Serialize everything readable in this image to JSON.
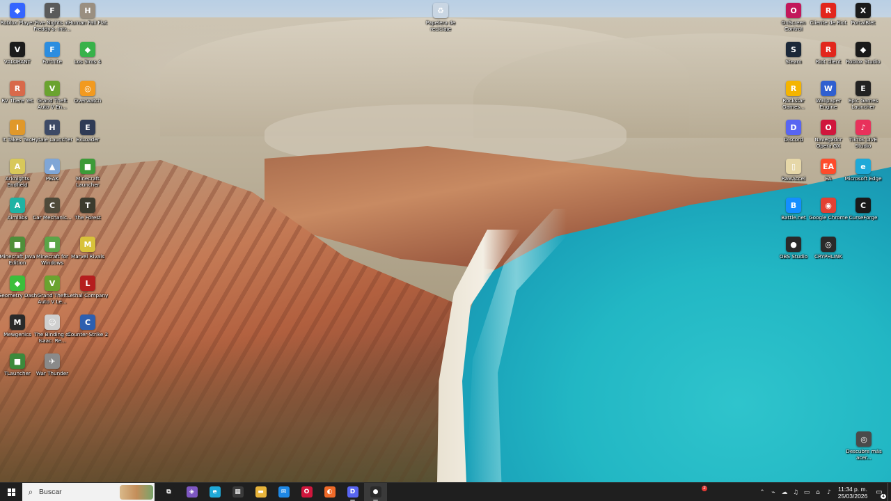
{
  "desktop": {
    "icons": [
      {
        "label": "Roblox Player",
        "icon": "roblox-icon",
        "color": "#3565ff",
        "glyph": "◆"
      },
      {
        "label": "Five Nights at Freddy's: Intr...",
        "icon": "fnaf-icon",
        "color": "#5a5a5a",
        "glyph": "F"
      },
      {
        "label": "Human Fall Flat",
        "icon": "human-fall-flat-icon",
        "color": "#9a8f80",
        "glyph": "H"
      },
      {
        "label": "VALORANT",
        "icon": "valorant-icon",
        "color": "#1b1b1b",
        "glyph": "V"
      },
      {
        "label": "Fortnite",
        "icon": "fortnite-icon",
        "color": "#2b8de0",
        "glyph": "F"
      },
      {
        "label": "Los Sims 4",
        "icon": "sims-icon",
        "color": "#38b24a",
        "glyph": "◆"
      },
      {
        "label": "RV There Yet",
        "icon": "rv-there-yet-icon",
        "color": "#d8694a",
        "glyph": "R"
      },
      {
        "label": "Grand Theft Auto V En...",
        "icon": "gta-v-icon",
        "color": "#6aa32f",
        "glyph": "V"
      },
      {
        "label": "Overwatch",
        "icon": "overwatch-icon",
        "color": "#f29a1f",
        "glyph": "◎"
      },
      {
        "label": "It Takes Two",
        "icon": "it-takes-two-icon",
        "color": "#e0982a",
        "glyph": "I"
      },
      {
        "label": "Hytale Launcher",
        "icon": "hytale-icon",
        "color": "#3d4a66",
        "glyph": "H"
      },
      {
        "label": "ExLoader",
        "icon": "exloader-icon",
        "color": "#2f3b55",
        "glyph": "E"
      },
      {
        "label": "Arknights Endfield",
        "icon": "arknights-icon",
        "color": "#d8c85a",
        "glyph": "A"
      },
      {
        "label": "PEAK",
        "icon": "peak-icon",
        "color": "#7fa6d6",
        "glyph": "▲"
      },
      {
        "label": "Minecraft Launcher",
        "icon": "minecraft-launcher-icon",
        "color": "#3c9b38",
        "glyph": "■"
      },
      {
        "label": "Aimlabs",
        "icon": "aimlabs-icon",
        "color": "#1fb3a4",
        "glyph": "A"
      },
      {
        "label": "Car Mechanic...",
        "icon": "car-mechanic-icon",
        "color": "#4e4a3a",
        "glyph": "C"
      },
      {
        "label": "The Forest",
        "icon": "the-forest-icon",
        "color": "#3b3b2e",
        "glyph": "T"
      },
      {
        "label": "Minecraft Java Edition",
        "icon": "minecraft-java-icon",
        "color": "#4f8f3a",
        "glyph": "■"
      },
      {
        "label": "Minecraft for Windows",
        "icon": "minecraft-windows-icon",
        "color": "#5aa548",
        "glyph": "■"
      },
      {
        "label": "Marvel Rivals",
        "icon": "marvel-rivals-icon",
        "color": "#d8c23a",
        "glyph": "M"
      },
      {
        "label": "Geometry Dash",
        "icon": "geometry-dash-icon",
        "color": "#3bbf3b",
        "glyph": "◆"
      },
      {
        "label": "Grand Theft Auto V Le...",
        "icon": "gta-v-legacy-icon",
        "color": "#6aa32f",
        "glyph": "V"
      },
      {
        "label": "Lethal Company",
        "icon": "lethal-company-icon",
        "color": "#b51e1e",
        "glyph": "L"
      },
      {
        "label": "Mewgenics",
        "icon": "mewgenics-icon",
        "color": "#2a2a2a",
        "glyph": "M"
      },
      {
        "label": "The Binding of Isaac: Re...",
        "icon": "binding-of-isaac-icon",
        "color": "#cfcfcf",
        "glyph": "☺"
      },
      {
        "label": "Counter-Strike 2",
        "icon": "counter-strike-icon",
        "color": "#2d5fb0",
        "glyph": "C"
      },
      {
        "label": "TLauncher",
        "icon": "tlauncher-icon",
        "color": "#3c8a3c",
        "glyph": "■"
      },
      {
        "label": "War Thunder",
        "icon": "war-thunder-icon",
        "color": "#8a8a8a",
        "glyph": "✈"
      },
      {
        "label": "Papelera de reciclaje",
        "icon": "recycle-bin-icon",
        "color": "#c9d6e3",
        "glyph": "♻"
      },
      {
        "label": "OnScreen Control",
        "icon": "onscreen-control-icon",
        "color": "#c2185b",
        "glyph": "O"
      },
      {
        "label": "Cliente de Riot",
        "icon": "riot-client-icon",
        "color": "#e2261c",
        "glyph": "R"
      },
      {
        "label": "PortalBlet",
        "icon": "portalblet-icon",
        "color": "#1a1a1a",
        "glyph": "X"
      },
      {
        "label": "Steam",
        "icon": "steam-icon",
        "color": "#1b2838",
        "glyph": "S"
      },
      {
        "label": "Riot client",
        "icon": "riot-client-2-icon",
        "color": "#e2261c",
        "glyph": "R"
      },
      {
        "label": "Roblox Studio",
        "icon": "roblox-studio-icon",
        "color": "#1a1a1a",
        "glyph": "◆"
      },
      {
        "label": "Rockstar Games...",
        "icon": "rockstar-icon",
        "color": "#f4b400",
        "glyph": "R"
      },
      {
        "label": "Wallpaper Engine",
        "icon": "wallpaper-engine-icon",
        "color": "#2f5fd0",
        "glyph": "W"
      },
      {
        "label": "Epic Games Launcher",
        "icon": "epic-games-icon",
        "color": "#222222",
        "glyph": "E"
      },
      {
        "label": "Discord",
        "icon": "discord-icon",
        "color": "#5865f2",
        "glyph": "D"
      },
      {
        "label": "Navegador Opera GX",
        "icon": "opera-gx-icon",
        "color": "#d0163c",
        "glyph": "O"
      },
      {
        "label": "TikTok LIVE Studio",
        "icon": "tiktok-live-icon",
        "color": "#e8315b",
        "glyph": "♪"
      },
      {
        "label": "RawAccel",
        "icon": "rawaccel-icon",
        "color": "#e6d7a8",
        "glyph": "▯"
      },
      {
        "label": "EA",
        "icon": "ea-icon",
        "color": "#ff4b2b",
        "glyph": "EA"
      },
      {
        "label": "Microsoft Edge",
        "icon": "edge-icon",
        "color": "#1fa9d8",
        "glyph": "e"
      },
      {
        "label": "Battle.net",
        "icon": "battlenet-icon",
        "color": "#148eff",
        "glyph": "B"
      },
      {
        "label": "Google Chrome",
        "icon": "chrome-icon",
        "color": "#e34133",
        "glyph": "◉"
      },
      {
        "label": "CurseForge",
        "icon": "curseforge-icon",
        "color": "#1a1a1a",
        "glyph": "C"
      },
      {
        "label": "OBS Studio",
        "icon": "obs-icon",
        "color": "#2a2a2a",
        "glyph": "●"
      },
      {
        "label": "CRYPHLINK",
        "icon": "cryphlink-icon",
        "color": "#2a2a2a",
        "glyph": "◎"
      },
      {
        "label": "Descubre más acer...",
        "icon": "discover-icon",
        "color": "#4a4a4a",
        "glyph": "◎"
      }
    ]
  },
  "taskbar": {
    "search_placeholder": "Buscar",
    "apps": [
      {
        "name": "task-view-icon",
        "glyph": "⧉",
        "color": "#1f1f1f"
      },
      {
        "name": "copilot-icon",
        "glyph": "◈",
        "color": "#7e57c2"
      },
      {
        "name": "edge-taskbar-icon",
        "glyph": "e",
        "color": "#1fa9d8"
      },
      {
        "name": "store-icon",
        "glyph": "▦",
        "color": "#3b3b3b"
      },
      {
        "name": "file-explorer-icon",
        "glyph": "▬",
        "color": "#e8b43a"
      },
      {
        "name": "mail-icon",
        "glyph": "✉",
        "color": "#1e88e5"
      },
      {
        "name": "opera-gx-taskbar-icon",
        "glyph": "O",
        "color": "#d0163c"
      },
      {
        "name": "orange-app-icon",
        "glyph": "◐",
        "color": "#f06a28"
      },
      {
        "name": "discord-taskbar-icon",
        "glyph": "D",
        "color": "#5865f2"
      },
      {
        "name": "obs-taskbar-icon",
        "glyph": "●",
        "color": "#2a2a2a"
      }
    ],
    "discord_badge": "2",
    "tray": {
      "chevron": "⌃",
      "icons": [
        "⌁",
        "☁",
        "♫",
        "▭",
        "⌂",
        "♪"
      ],
      "time": "11:34 p. m.",
      "date": "25/03/2026",
      "notifications": "4"
    }
  }
}
